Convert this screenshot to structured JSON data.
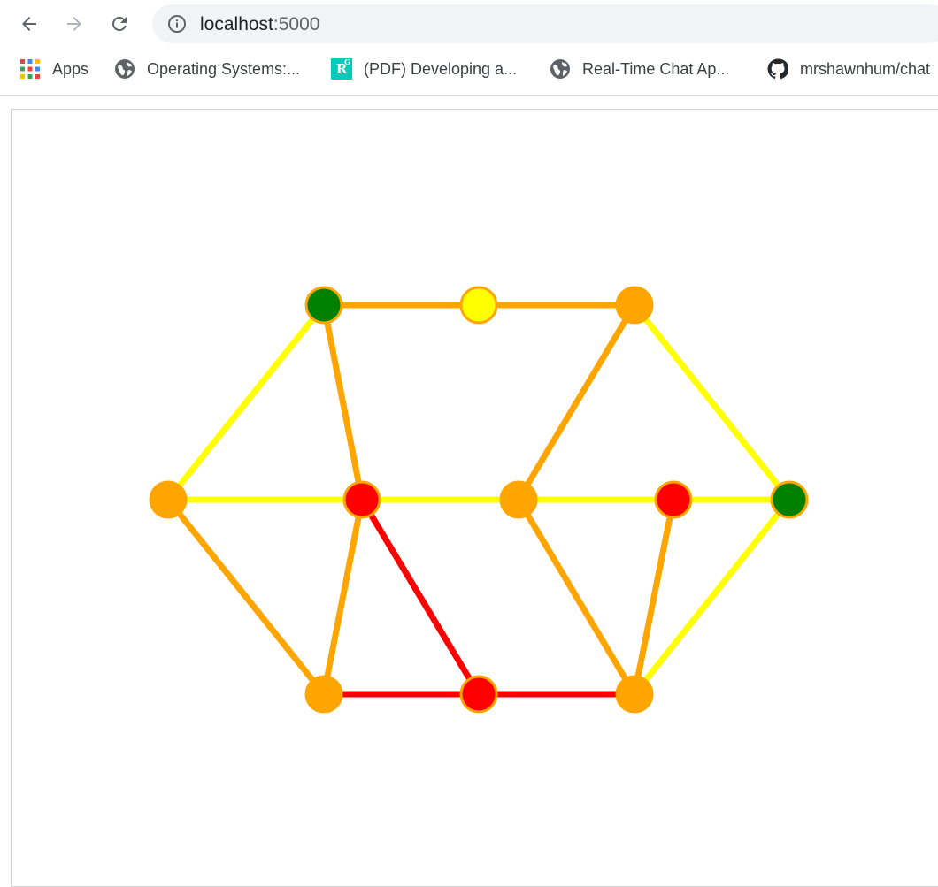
{
  "browser": {
    "url_host": "localhost",
    "url_port": ":5000",
    "nav": {
      "back_icon": "arrow-left-icon",
      "forward_icon": "arrow-right-icon",
      "reload_icon": "reload-icon",
      "info_icon": "info-icon"
    },
    "bookmarks": [
      {
        "label": "Apps",
        "icon": "apps-grid-icon"
      },
      {
        "label": "Operating Systems:...",
        "icon": "globe-icon"
      },
      {
        "label": "(PDF) Developing a...",
        "icon": "researchgate-icon"
      },
      {
        "label": "Real-Time Chat Ap...",
        "icon": "globe-icon"
      },
      {
        "label": "mrshawnhum/chat",
        "icon": "github-icon"
      }
    ]
  },
  "graph": {
    "colors": {
      "red": "#ff0000",
      "orange": "#ffa500",
      "yellow": "#ffff00",
      "green": "#008000",
      "node_border": "#ffa500"
    },
    "nodes": [
      {
        "id": "n0",
        "color": "orange"
      },
      {
        "id": "n1",
        "color": "green"
      },
      {
        "id": "n2",
        "color": "yellow"
      },
      {
        "id": "n3",
        "color": "orange"
      },
      {
        "id": "n4",
        "color": "red"
      },
      {
        "id": "n5",
        "color": "orange"
      },
      {
        "id": "n6",
        "color": "red"
      },
      {
        "id": "n7",
        "color": "green"
      },
      {
        "id": "n8",
        "color": "orange"
      },
      {
        "id": "n9",
        "color": "red"
      },
      {
        "id": "n10",
        "color": "orange"
      }
    ],
    "edges": [
      {
        "from": "n1",
        "to": "n2",
        "color": "orange"
      },
      {
        "from": "n2",
        "to": "n3",
        "color": "orange"
      },
      {
        "from": "n0",
        "to": "n1",
        "color": "yellow"
      },
      {
        "from": "n1",
        "to": "n4",
        "color": "orange"
      },
      {
        "from": "n3",
        "to": "n5",
        "color": "orange"
      },
      {
        "from": "n3",
        "to": "n7",
        "color": "yellow"
      },
      {
        "from": "n0",
        "to": "n4",
        "color": "yellow"
      },
      {
        "from": "n4",
        "to": "n5",
        "color": "yellow"
      },
      {
        "from": "n5",
        "to": "n6",
        "color": "yellow"
      },
      {
        "from": "n6",
        "to": "n7",
        "color": "yellow"
      },
      {
        "from": "n0",
        "to": "n8",
        "color": "orange"
      },
      {
        "from": "n4",
        "to": "n8",
        "color": "orange"
      },
      {
        "from": "n4",
        "to": "n9",
        "color": "red"
      },
      {
        "from": "n5",
        "to": "n10",
        "color": "orange"
      },
      {
        "from": "n6",
        "to": "n10",
        "color": "orange"
      },
      {
        "from": "n7",
        "to": "n10",
        "color": "yellow"
      },
      {
        "from": "n8",
        "to": "n9",
        "color": "red"
      },
      {
        "from": "n9",
        "to": "n10",
        "color": "red"
      }
    ]
  }
}
